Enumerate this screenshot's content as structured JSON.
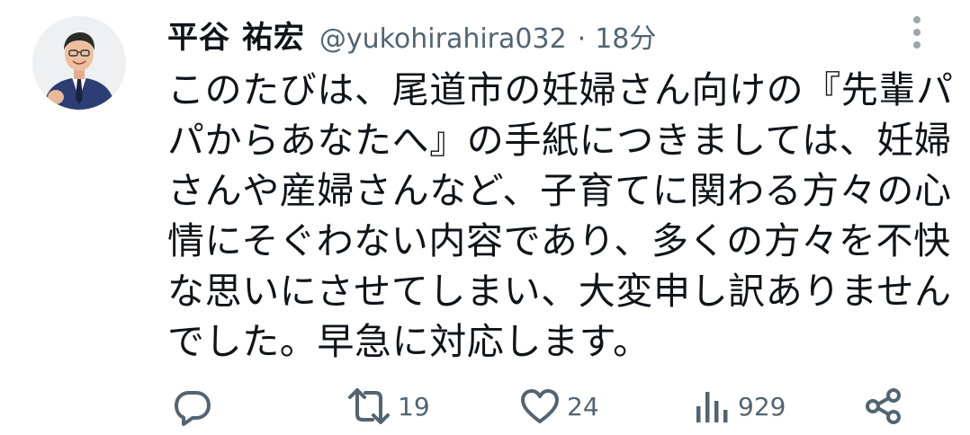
{
  "author": {
    "name": "平谷 祐宏",
    "handle": "@yukohirahira032",
    "separator": "·",
    "time": "18分",
    "avatar_icon": "person-avatar"
  },
  "tweet": {
    "lines": [
      "このたびは、尾道市の妊婦さん向けの『先輩パ",
      "パからあなたへ』の手紙につきましては、妊婦",
      "さんや産婦さんなど、子育てに関わる方々の心",
      "情にそぐわない内容であり、多くの方々を不快",
      "な思いにさせてしまい、大変申し訳ありません",
      "でした。早急に対応します。"
    ]
  },
  "actions": {
    "reply_icon": "reply-icon",
    "retweet_icon": "retweet-icon",
    "retweet_count": "19",
    "like_icon": "heart-icon",
    "like_count": "24",
    "views_icon": "views-icon",
    "views_count": "929",
    "share_icon": "share-icon"
  },
  "colors": {
    "text": "#0f1419",
    "secondary": "#536471",
    "icon": "#536471"
  }
}
